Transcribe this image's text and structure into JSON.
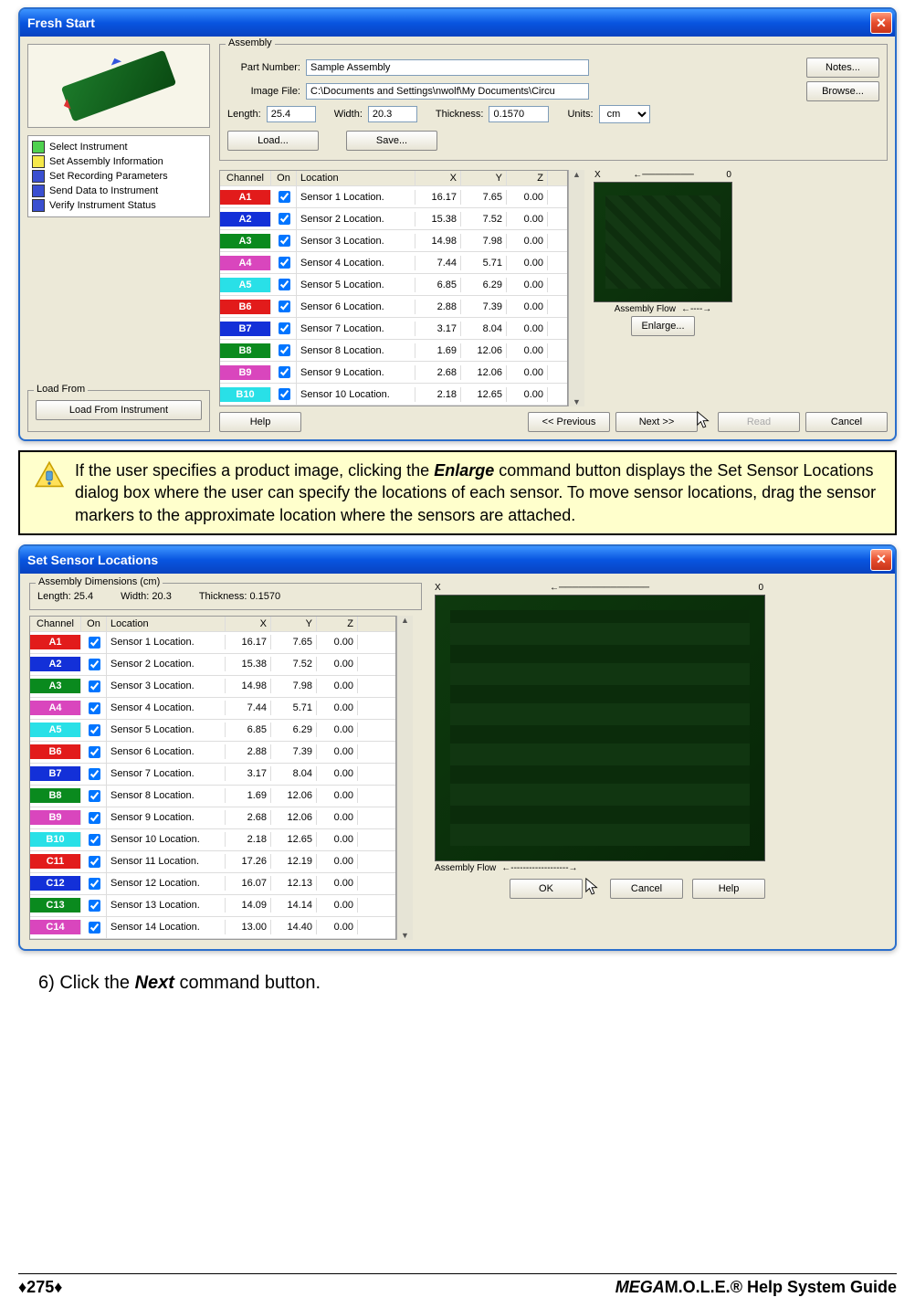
{
  "win1": {
    "title": "Fresh Start",
    "steps": [
      {
        "color": "#4fd14f",
        "label": "Select Instrument"
      },
      {
        "color": "#f5e84a",
        "label": "Set Assembly Information"
      },
      {
        "color": "#3a4fd0",
        "label": "Set Recording Parameters"
      },
      {
        "color": "#3a4fd0",
        "label": "Send Data to Instrument"
      },
      {
        "color": "#3a4fd0",
        "label": "Verify Instrument Status"
      }
    ],
    "loadfrom_legend": "Load From",
    "loadfrom_btn": "Load From Instrument",
    "assy_legend": "Assembly",
    "part_lbl": "Part Number:",
    "part_val": "Sample Assembly",
    "img_lbl": "Image File:",
    "img_val": "C:\\Documents and Settings\\nwolf\\My Documents\\Circu",
    "len_lbl": "Length:",
    "len_val": "25.4",
    "wid_lbl": "Width:",
    "wid_val": "20.3",
    "thk_lbl": "Thickness:",
    "thk_val": "0.1570",
    "units_lbl": "Units:",
    "units_val": "cm",
    "notes_btn": "Notes...",
    "browse_btn": "Browse...",
    "load_btn": "Load...",
    "save_btn": "Save...",
    "cols": {
      "ch": "Channel",
      "on": "On",
      "loc": "Location",
      "x": "X",
      "y": "Y",
      "z": "Z"
    },
    "channels": [
      {
        "id": "A1",
        "bg": "#e21b1b",
        "loc": "Sensor 1 Location.",
        "x": "16.17",
        "y": "7.65",
        "z": "0.00"
      },
      {
        "id": "A2",
        "bg": "#1330d8",
        "loc": "Sensor 2 Location.",
        "x": "15.38",
        "y": "7.52",
        "z": "0.00"
      },
      {
        "id": "A3",
        "bg": "#0a8a1e",
        "loc": "Sensor 3 Location.",
        "x": "14.98",
        "y": "7.98",
        "z": "0.00"
      },
      {
        "id": "A4",
        "bg": "#d946bd",
        "loc": "Sensor 4 Location.",
        "x": "7.44",
        "y": "5.71",
        "z": "0.00"
      },
      {
        "id": "A5",
        "bg": "#29e0e7",
        "loc": "Sensor 5 Location.",
        "x": "6.85",
        "y": "6.29",
        "z": "0.00"
      },
      {
        "id": "B6",
        "bg": "#e21b1b",
        "loc": "Sensor 6 Location.",
        "x": "2.88",
        "y": "7.39",
        "z": "0.00"
      },
      {
        "id": "B7",
        "bg": "#1330d8",
        "loc": "Sensor 7 Location.",
        "x": "3.17",
        "y": "8.04",
        "z": "0.00"
      },
      {
        "id": "B8",
        "bg": "#0a8a1e",
        "loc": "Sensor 8 Location.",
        "x": "1.69",
        "y": "12.06",
        "z": "0.00"
      },
      {
        "id": "B9",
        "bg": "#d946bd",
        "loc": "Sensor 9 Location.",
        "x": "2.68",
        "y": "12.06",
        "z": "0.00"
      },
      {
        "id": "B10",
        "bg": "#29e0e7",
        "loc": "Sensor 10 Location.",
        "x": "2.18",
        "y": "12.65",
        "z": "0.00"
      }
    ],
    "axis_x": "X",
    "axis_0": "0",
    "assy_flow": "Assembly Flow",
    "enlarge_btn": "Enlarge...",
    "help": "Help",
    "prev": "<< Previous",
    "next": "Next >>",
    "read": "Read",
    "cancel": "Cancel"
  },
  "info": {
    "t1": "If the user specifies a product image, clicking the ",
    "enlarge": "Enlarge",
    "t2": " command button displays the Set Sensor Locations dialog box where the user can specify the locations of each sensor. To move sensor locations, drag the sensor markers to the approximate location where the sensors are attached."
  },
  "win2": {
    "title": "Set Sensor Locations",
    "dim_legend": "Assembly Dimensions (cm)",
    "len": "Length:  25.4",
    "wid": "Width:  20.3",
    "thk": "Thickness:  0.1570",
    "channels": [
      {
        "id": "A1",
        "bg": "#e21b1b",
        "loc": "Sensor 1 Location.",
        "x": "16.17",
        "y": "7.65",
        "z": "0.00"
      },
      {
        "id": "A2",
        "bg": "#1330d8",
        "loc": "Sensor 2 Location.",
        "x": "15.38",
        "y": "7.52",
        "z": "0.00"
      },
      {
        "id": "A3",
        "bg": "#0a8a1e",
        "loc": "Sensor 3 Location.",
        "x": "14.98",
        "y": "7.98",
        "z": "0.00"
      },
      {
        "id": "A4",
        "bg": "#d946bd",
        "loc": "Sensor 4 Location.",
        "x": "7.44",
        "y": "5.71",
        "z": "0.00"
      },
      {
        "id": "A5",
        "bg": "#29e0e7",
        "loc": "Sensor 5 Location.",
        "x": "6.85",
        "y": "6.29",
        "z": "0.00"
      },
      {
        "id": "B6",
        "bg": "#e21b1b",
        "loc": "Sensor 6 Location.",
        "x": "2.88",
        "y": "7.39",
        "z": "0.00"
      },
      {
        "id": "B7",
        "bg": "#1330d8",
        "loc": "Sensor 7 Location.",
        "x": "3.17",
        "y": "8.04",
        "z": "0.00"
      },
      {
        "id": "B8",
        "bg": "#0a8a1e",
        "loc": "Sensor 8 Location.",
        "x": "1.69",
        "y": "12.06",
        "z": "0.00"
      },
      {
        "id": "B9",
        "bg": "#d946bd",
        "loc": "Sensor 9 Location.",
        "x": "2.68",
        "y": "12.06",
        "z": "0.00"
      },
      {
        "id": "B10",
        "bg": "#29e0e7",
        "loc": "Sensor 10 Location.",
        "x": "2.18",
        "y": "12.65",
        "z": "0.00"
      },
      {
        "id": "C11",
        "bg": "#e21b1b",
        "loc": "Sensor 11 Location.",
        "x": "17.26",
        "y": "12.19",
        "z": "0.00"
      },
      {
        "id": "C12",
        "bg": "#1330d8",
        "loc": "Sensor 12 Location.",
        "x": "16.07",
        "y": "12.13",
        "z": "0.00"
      },
      {
        "id": "C13",
        "bg": "#0a8a1e",
        "loc": "Sensor 13 Location.",
        "x": "14.09",
        "y": "14.14",
        "z": "0.00"
      },
      {
        "id": "C14",
        "bg": "#d946bd",
        "loc": "Sensor 14 Location.",
        "x": "13.00",
        "y": "14.40",
        "z": "0.00"
      }
    ],
    "ok": "OK",
    "cancel": "Cancel",
    "help": "Help",
    "assy_flow": "Assembly Flow"
  },
  "step6": {
    "num": "6)",
    "pre": "  Click the ",
    "bold": "Next",
    "post": " command button."
  },
  "footer": {
    "page": "♦275♦",
    "brand_b": "MEGA",
    "brand_rest": "M.O.L.E.® Help System Guide"
  }
}
